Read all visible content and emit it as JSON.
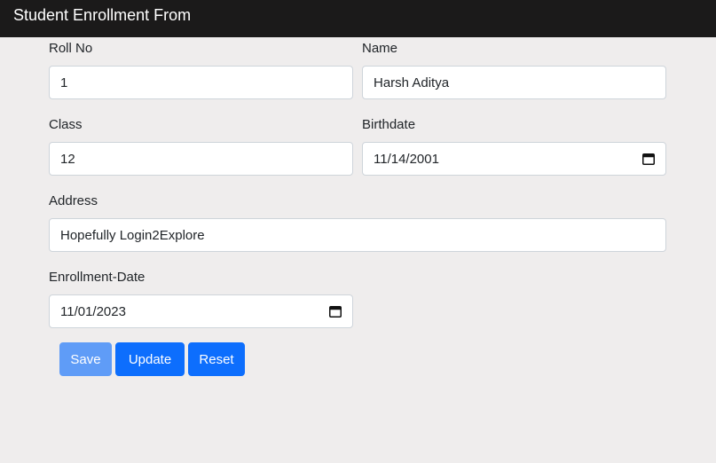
{
  "header": {
    "title": "Student Enrollment From"
  },
  "form": {
    "roll_no": {
      "label": "Roll No",
      "value": "1"
    },
    "name": {
      "label": "Name",
      "value": "Harsh Aditya"
    },
    "class": {
      "label": "Class",
      "value": "12"
    },
    "birthdate": {
      "label": "Birthdate",
      "value": "11/14/2001"
    },
    "address": {
      "label": "Address",
      "value": "Hopefully Login2Explore"
    },
    "enrollment_date": {
      "label": "Enrollment-Date",
      "value": "11/01/2023"
    }
  },
  "buttons": {
    "save": "Save",
    "update": "Update",
    "reset": "Reset"
  },
  "icons": {
    "date_picker": "calendar-icon"
  },
  "colors": {
    "primary": "#0d6efd",
    "primary_disabled": "#5f9cf7",
    "header_bg": "#1b1a1a"
  }
}
